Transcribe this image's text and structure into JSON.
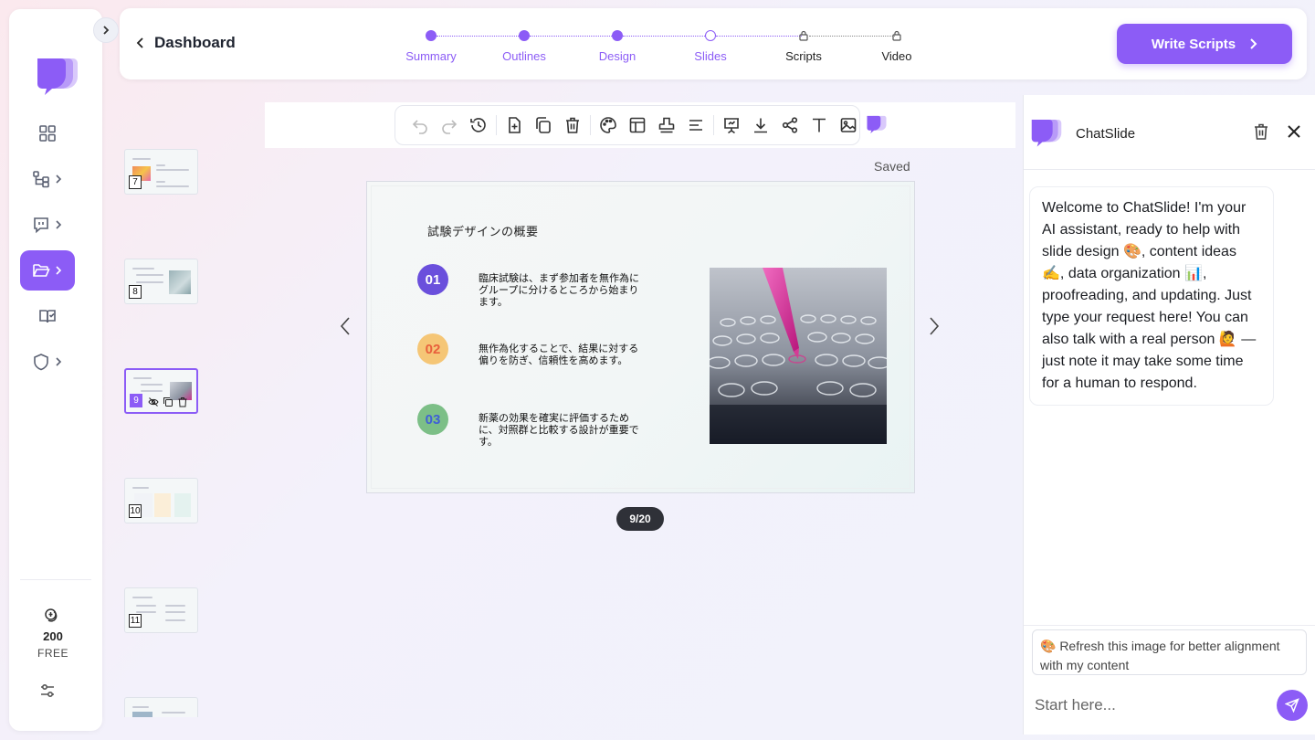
{
  "header": {
    "back_label": "Dashboard",
    "steps": [
      {
        "label": "Summary",
        "state": "done"
      },
      {
        "label": "Outlines",
        "state": "done"
      },
      {
        "label": "Design",
        "state": "done"
      },
      {
        "label": "Slides",
        "state": "current"
      },
      {
        "label": "Scripts",
        "state": "locked"
      },
      {
        "label": "Video",
        "state": "locked"
      }
    ],
    "cta_label": "Write Scripts"
  },
  "sidebar": {
    "items": [
      {
        "icon": "grid-icon",
        "has_submenu": false,
        "active": false
      },
      {
        "icon": "tree-icon",
        "has_submenu": true,
        "active": false
      },
      {
        "icon": "chat-bubble-icon",
        "has_submenu": true,
        "active": false
      },
      {
        "icon": "folder-icon",
        "has_submenu": true,
        "active": true
      },
      {
        "icon": "book-icon",
        "has_submenu": false,
        "active": false
      },
      {
        "icon": "shield-icon",
        "has_submenu": true,
        "active": false
      }
    ],
    "credits": "200",
    "plan": "FREE"
  },
  "thumbnails": [
    {
      "number": "7"
    },
    {
      "number": "8"
    },
    {
      "number": "9",
      "selected": true
    },
    {
      "number": "10"
    },
    {
      "number": "11"
    },
    {
      "number": ""
    }
  ],
  "editor": {
    "status": "Saved",
    "page_indicator": "9/20"
  },
  "slide": {
    "title": "試験デザインの概要",
    "points": [
      {
        "badge": "01",
        "text": "臨床試験は、まず参加者を無作為にグループに分けるところから始まります。",
        "color": "#6a4fdc"
      },
      {
        "badge": "02",
        "text": "無作為化することで、結果に対する偏りを防ぎ、信頼性を高めます。",
        "color": "#f5c676"
      },
      {
        "badge": "03",
        "text": "新薬の効果を確実に評価するために、対照群と比較する設計が重要です。",
        "color": "#7cbf87"
      }
    ]
  },
  "chat": {
    "title": "ChatSlide",
    "welcome": "Welcome to ChatSlide! I'm your AI assistant, ready to help with slide design 🎨, content ideas ✍️, data organization 📊, proofreading, and updating. Just type your request here! You can also talk with a real person 🙋 — just note it may take some time for a human to respond.",
    "suggestion": "🎨 Refresh this image for better alignment with my content",
    "input_placeholder": "Start here..."
  },
  "colors": {
    "accent": "#8c5cf6",
    "badge_01": "#6a4fdc",
    "badge_02": "#f5c676",
    "badge_03": "#7cbf87"
  }
}
